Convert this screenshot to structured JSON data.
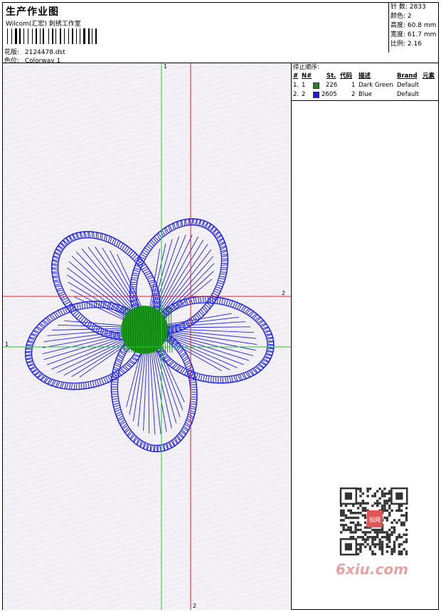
{
  "header": {
    "title": "生产作业图",
    "company": "Wilcom(汇宏) 刺绣工作室",
    "pattern_label": "花版:",
    "pattern_value": "2124478.dst",
    "colorway_label": "色位:",
    "colorway_value": "Colorway 1"
  },
  "stats": [
    {
      "label": "针 数:",
      "value": "2833"
    },
    {
      "label": "颜色:",
      "value": "2"
    },
    {
      "label": "高度:",
      "value": "60.8 mm"
    },
    {
      "label": "宽度:",
      "value": "61.7 mm"
    },
    {
      "label": "比例:",
      "value": "2.16"
    }
  ],
  "stop_sequence": {
    "title": "停止顺序:",
    "columns": [
      "#",
      "N#",
      "St.",
      "代码",
      "描述",
      "Brand",
      "元素"
    ],
    "rows": [
      {
        "index": "1.",
        "needle": "1",
        "color": "#1a8a1a",
        "stitches": "226",
        "code": "1",
        "description": "Dark Green",
        "brand": "Default"
      },
      {
        "index": "2.",
        "needle": "2",
        "color": "#1a1ae0",
        "stitches": "2605",
        "code": "2",
        "description": "Blue",
        "brand": "Default"
      }
    ]
  },
  "guides": {
    "green_label_top": "1",
    "green_label_left": "1",
    "red_label_right": "2",
    "red_label_bottom": "2"
  },
  "colors": {
    "petal": "#1e22e6",
    "center": "#1a9a1a",
    "guide_green": "#22cc22",
    "guide_red": "#dd2222"
  },
  "watermark": {
    "text": "6xiu.com",
    "stamp": "锐网"
  }
}
